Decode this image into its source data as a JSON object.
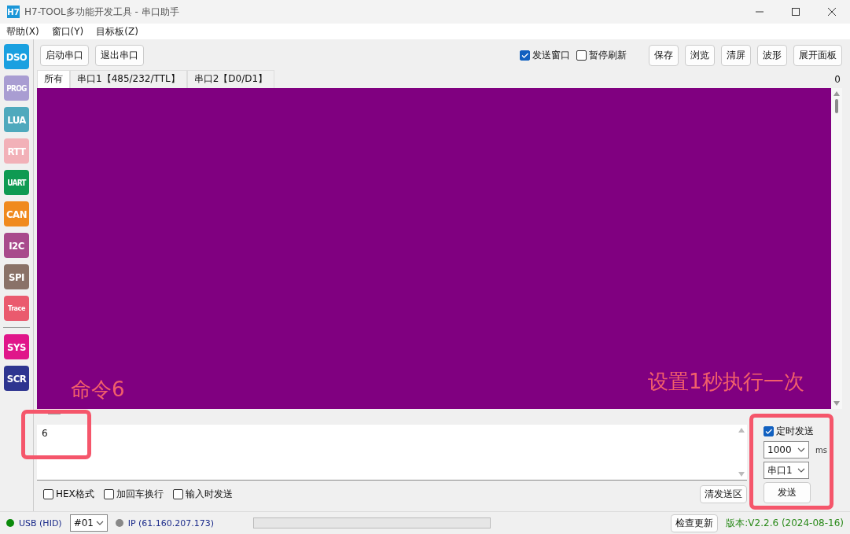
{
  "window": {
    "title": "H7-TOOL多功能开发工具 - 串口助手",
    "app_icon": "H7"
  },
  "menu": [
    "帮助(X)",
    "窗口(Y)",
    "目标板(Z)"
  ],
  "sidebar": {
    "groups": [
      [
        {
          "label": "DSO",
          "color": "#1aa0e0"
        },
        {
          "label": "PROG",
          "color": "#a99dd2"
        },
        {
          "label": "LUA",
          "color": "#4fa9bd"
        },
        {
          "label": "RTT",
          "color": "#f2b1b8"
        },
        {
          "label": "UART",
          "color": "#0e9a52"
        },
        {
          "label": "CAN",
          "color": "#f08a1e"
        },
        {
          "label": "I2C",
          "color": "#a84a8c"
        },
        {
          "label": "SPI",
          "color": "#8a7268"
        },
        {
          "label": "Trace",
          "color": "#ea5a6e"
        }
      ],
      [
        {
          "label": "SYS",
          "color": "#e0168a"
        },
        {
          "label": "SCR",
          "color": "#2e3590"
        }
      ]
    ]
  },
  "toolbar": {
    "left_buttons": [
      "启动串口",
      "退出串口"
    ],
    "checkboxes": [
      {
        "label": "发送窗口",
        "checked": true
      },
      {
        "label": "暂停刷新",
        "checked": false
      }
    ],
    "right_buttons": [
      "保存",
      "浏览",
      "清屏",
      "波形",
      "展开面板"
    ]
  },
  "tabs": [
    {
      "label": "所有",
      "selected": true
    },
    {
      "label": "串口1【485/232/TTL】",
      "selected": false
    },
    {
      "label": "串口2【D0/D1】",
      "selected": false
    }
  ],
  "receive_count": "0",
  "send": {
    "value": "6",
    "options": [
      {
        "label": "HEX格式",
        "checked": false
      },
      {
        "label": "加回车换行",
        "checked": false
      },
      {
        "label": "输入时发送",
        "checked": false
      }
    ],
    "clear_button": "清发送区",
    "timer": {
      "label": "定时发送",
      "checked": true
    },
    "interval": "1000",
    "unit": "ms",
    "port": "串口1",
    "send_button": "发送"
  },
  "annotations": {
    "left": "命令6",
    "right": "设置1秒执行一次"
  },
  "status_bar": {
    "usb": {
      "label": "USB (HID)",
      "connected": true
    },
    "device": "#01",
    "ip": {
      "label": "IP (61.160.207.173)",
      "connected": false
    },
    "update_button": "检查更新",
    "version": "版本:V2.2.6 (2024-08-16)"
  }
}
